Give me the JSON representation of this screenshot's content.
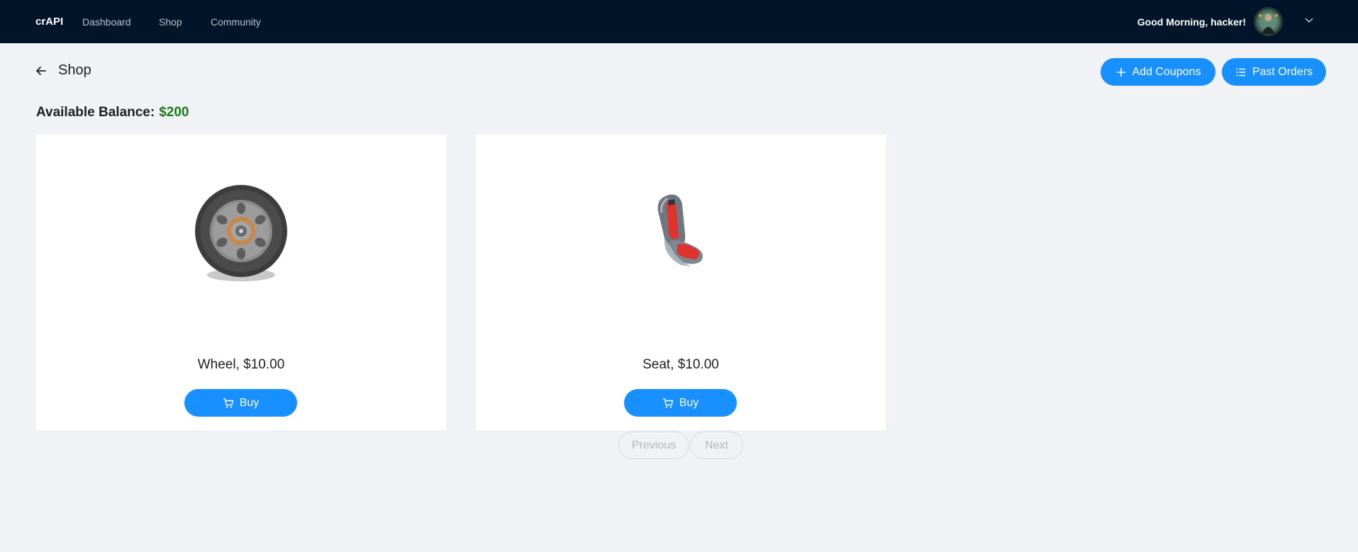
{
  "nav": {
    "brand": "crAPI",
    "links": [
      "Dashboard",
      "Shop",
      "Community"
    ],
    "greeting": "Good Morning, hacker!"
  },
  "page": {
    "title": "Shop",
    "add_coupons_label": "Add Coupons",
    "past_orders_label": "Past Orders",
    "balance_label": "Available Balance:",
    "balance_value": "$200"
  },
  "products": [
    {
      "name": "Wheel, $10.00",
      "buy_label": "Buy",
      "icon": "wheel-image"
    },
    {
      "name": "Seat, $10.00",
      "buy_label": "Buy",
      "icon": "seat-image"
    }
  ],
  "pagination": {
    "previous_label": "Previous",
    "next_label": "Next"
  },
  "colors": {
    "nav_bg": "#001529",
    "accent": "#1890ff",
    "balance": "#1a7d1a",
    "page_bg": "#f0f2f5"
  }
}
